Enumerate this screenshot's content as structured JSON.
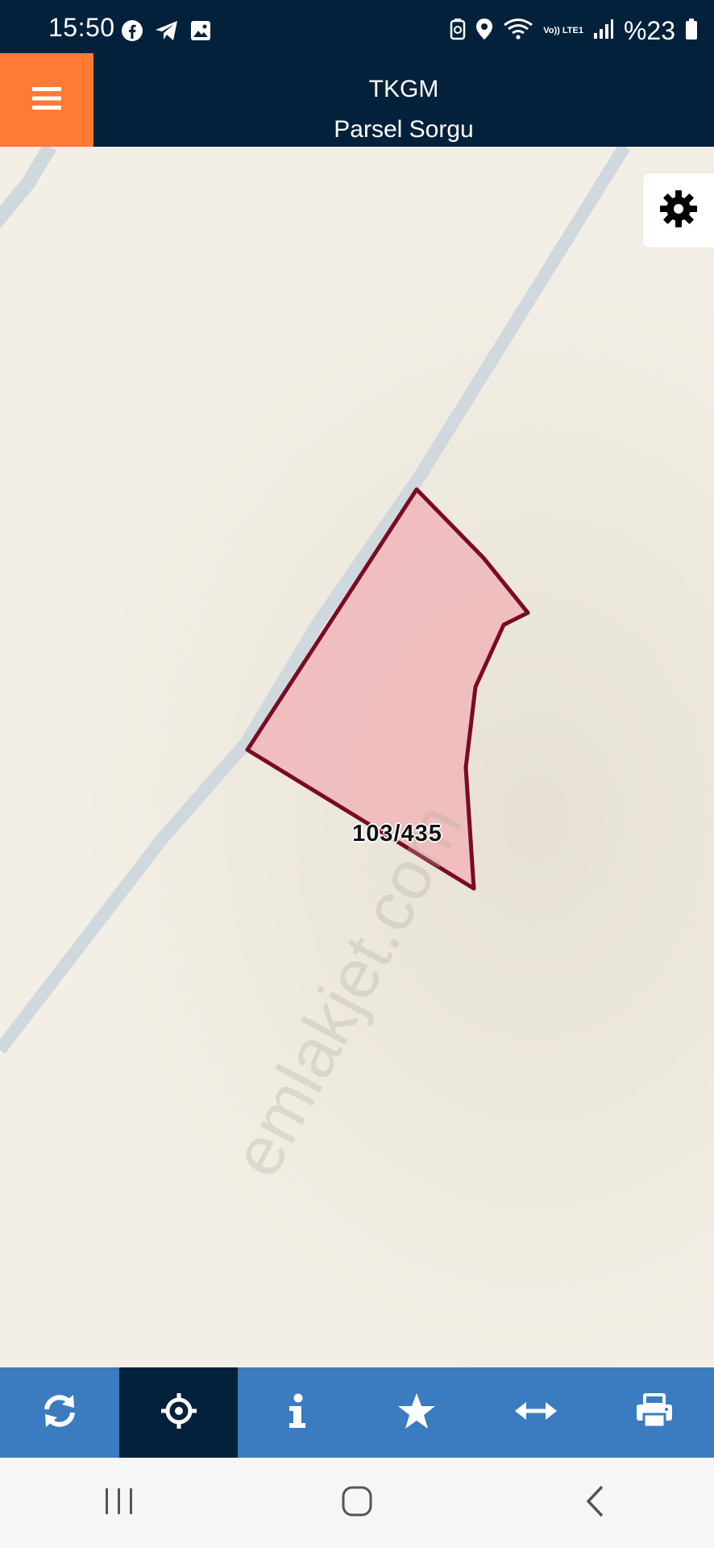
{
  "status_bar": {
    "time": "15:50",
    "left_icons": [
      "facebook-icon",
      "telegram-icon",
      "gallery-icon"
    ],
    "right_icons": [
      "battery-saver-icon",
      "location-icon",
      "wifi-icon",
      "volte-lte-icon",
      "signal-icon",
      "battery-icon"
    ],
    "volte_label": "Vo)) LTE1",
    "battery": "%23"
  },
  "header": {
    "title": "TKGM",
    "subtitle": "Parsel Sorgu",
    "menu_color": "#ff7a35",
    "background": "#04213b"
  },
  "map": {
    "parcel_label": "103/435",
    "watermark": "emlakjet.com",
    "parcel_fill": "#efbcbc",
    "parcel_stroke": "#7a0a26",
    "road_color": "#cfd8dd"
  },
  "toolbar": {
    "background": "#3b7bbf",
    "active_background": "#04213b",
    "items": [
      {
        "icon": "refresh-icon",
        "active": false
      },
      {
        "icon": "locate-icon",
        "active": true
      },
      {
        "icon": "info-icon",
        "active": false
      },
      {
        "icon": "star-icon",
        "active": false
      },
      {
        "icon": "measure-icon",
        "active": false
      },
      {
        "icon": "print-icon",
        "active": false
      }
    ]
  },
  "nav_bar": {
    "buttons": [
      "recent-apps-icon",
      "home-icon",
      "back-icon"
    ]
  }
}
